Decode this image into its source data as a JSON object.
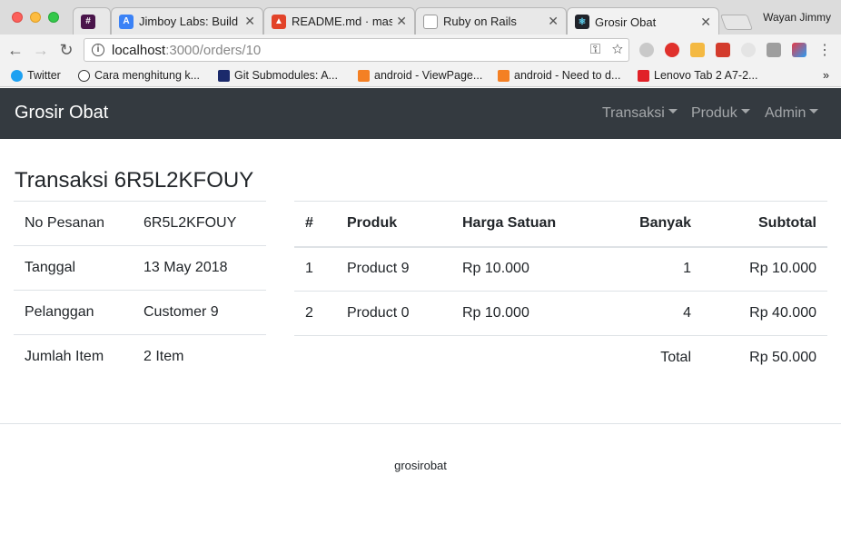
{
  "browser": {
    "tabs": [
      {
        "title": "#",
        "favicon_color": "#4a154b"
      },
      {
        "title": "Jimboy Labs: Build S",
        "favicon_color": "#3b82f6"
      },
      {
        "title": "README.md · maste",
        "favicon_color": "#e24329"
      },
      {
        "title": "Ruby on Rails",
        "favicon_color": "#999999"
      },
      {
        "title": "Grosir Obat",
        "favicon_color": "#20232a"
      }
    ],
    "profile_name": "Wayan Jimmy",
    "url_host": "localhost",
    "url_rest": ":3000/orders/10",
    "bookmarks": [
      {
        "label": "Twitter",
        "icon": "twitter-icon"
      },
      {
        "label": "Cara menghitung k...",
        "icon": "site-icon"
      },
      {
        "label": "Git Submodules: A...",
        "icon": "site-icon"
      },
      {
        "label": "android - ViewPage...",
        "icon": "stackoverflow-icon"
      },
      {
        "label": "android - Need to d...",
        "icon": "stackoverflow-icon"
      },
      {
        "label": "Lenovo Tab 2 A7-2...",
        "icon": "site-icon"
      }
    ],
    "bookmarks_overflow": "»"
  },
  "navbar": {
    "brand": "Grosir Obat",
    "items": [
      "Transaksi",
      "Produk",
      "Admin"
    ]
  },
  "page": {
    "title": "Transaksi 6R5L2KFOUY"
  },
  "order_info": [
    {
      "label": "No Pesanan",
      "value": "6R5L2KFOUY"
    },
    {
      "label": "Tanggal",
      "value": "13 May 2018"
    },
    {
      "label": "Pelanggan",
      "value": "Customer 9"
    },
    {
      "label": "Jumlah Item",
      "value": "2 Item"
    }
  ],
  "items_table": {
    "headers": [
      "#",
      "Produk",
      "Harga Satuan",
      "Banyak",
      "Subtotal"
    ],
    "rows": [
      [
        "1",
        "Product 9",
        "Rp 10.000",
        "1",
        "Rp 10.000"
      ],
      [
        "2",
        "Product 0",
        "Rp 10.000",
        "4",
        "Rp 40.000"
      ]
    ],
    "total_label": "Total",
    "total_value": "Rp 50.000"
  },
  "footer": {
    "text": "grosirobat"
  }
}
